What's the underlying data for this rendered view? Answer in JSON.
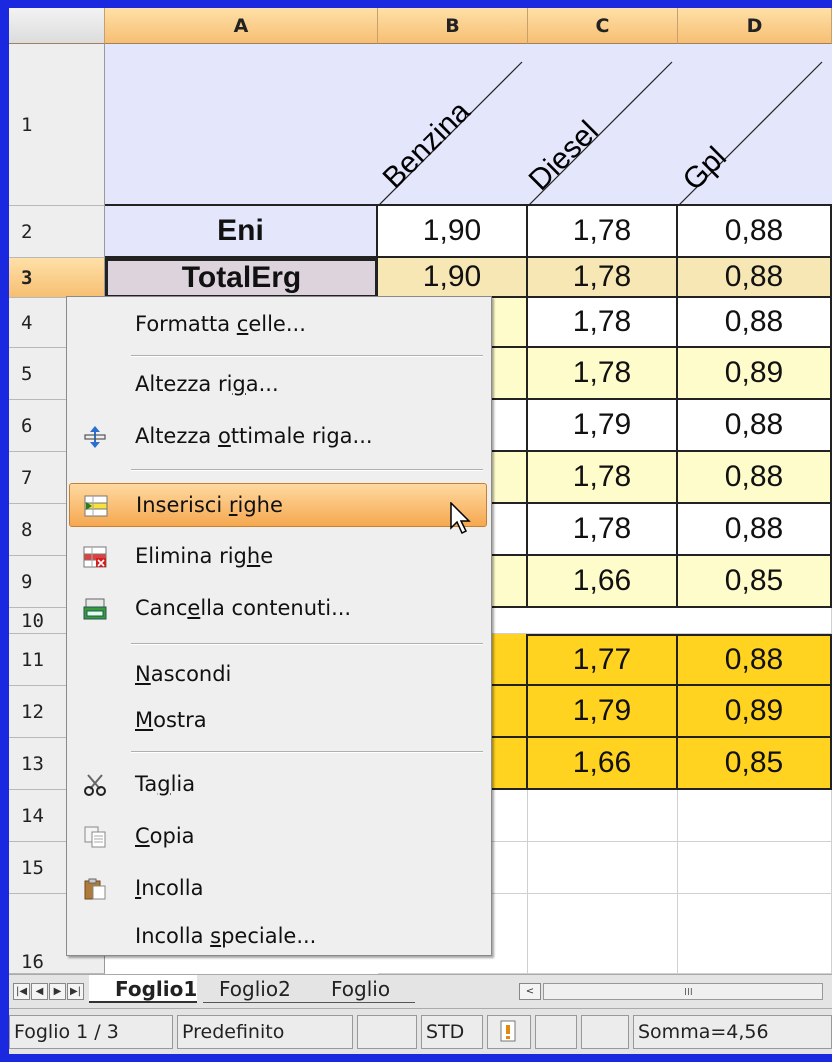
{
  "columns": [
    "A",
    "B",
    "C",
    "D"
  ],
  "header_fuels": [
    "Benzina",
    "Diesel",
    "Gpl"
  ],
  "rows": [
    {
      "num": "1"
    },
    {
      "num": "2",
      "name": "Eni",
      "b": "1,90",
      "c": "1,78",
      "d": "0,88"
    },
    {
      "num": "3",
      "name": "TotalErg",
      "b": "1,90",
      "c": "1,78",
      "d": "0,88"
    },
    {
      "num": "4",
      "c": "1,78",
      "d": "0,88"
    },
    {
      "num": "5",
      "c": "1,78",
      "d": "0,89"
    },
    {
      "num": "6",
      "c": "1,79",
      "d": "0,88"
    },
    {
      "num": "7",
      "c": "1,78",
      "d": "0,88"
    },
    {
      "num": "8",
      "c": "1,78",
      "d": "0,88"
    },
    {
      "num": "9",
      "c": "1,66",
      "d": "0,85"
    },
    {
      "num": "10"
    },
    {
      "num": "11",
      "c": "1,77",
      "d": "0,88"
    },
    {
      "num": "12",
      "c": "1,79",
      "d": "0,89"
    },
    {
      "num": "13",
      "c": "1,66",
      "d": "0,85"
    },
    {
      "num": "14"
    },
    {
      "num": "15"
    },
    {
      "num": "16"
    }
  ],
  "menu": {
    "formatta_celle": {
      "pre": "Formatta ",
      "u": "c",
      "post": "elle..."
    },
    "altezza_riga": {
      "pre": "Altezza ri",
      "u": "g",
      "post": "a..."
    },
    "altezza_ottimale": {
      "pre": "Altezza ",
      "u": "o",
      "post": "ttimale riga..."
    },
    "inserisci_righe": {
      "pre": "Inserisci ",
      "u": "r",
      "post": "ighe"
    },
    "elimina_righe": {
      "pre": "Elimina rig",
      "u": "h",
      "post": "e"
    },
    "cancella_contenuti": {
      "pre": "Canc",
      "u": "e",
      "post": "lla contenuti..."
    },
    "nascondi": {
      "pre": "",
      "u": "N",
      "post": "ascondi"
    },
    "mostra": {
      "pre": "",
      "u": "M",
      "post": "ostra"
    },
    "taglia": {
      "pre": "Ta",
      "u": "g",
      "post": "lia"
    },
    "copia": {
      "pre": "",
      "u": "C",
      "post": "opia"
    },
    "incolla": {
      "pre": "",
      "u": "I",
      "post": "ncolla"
    },
    "incolla_speciale": {
      "pre": "Incolla ",
      "u": "s",
      "post": "peciale..."
    }
  },
  "tabs": [
    "Foglio1",
    "Foglio2",
    "Foglio"
  ],
  "status": {
    "sheet": "Foglio 1 / 3",
    "style": "Predefinito",
    "mode": "STD",
    "sum": "Somma=4,56"
  },
  "colors": {
    "frame": "#1a29e0",
    "header_orange": "#f6bf73",
    "lavender": "#e4e6fb",
    "pale_yellow": "#fffccc",
    "gold": "#ffd320",
    "selected_row": "#f7e7b5",
    "menu_highlight": "#f5a850"
  }
}
